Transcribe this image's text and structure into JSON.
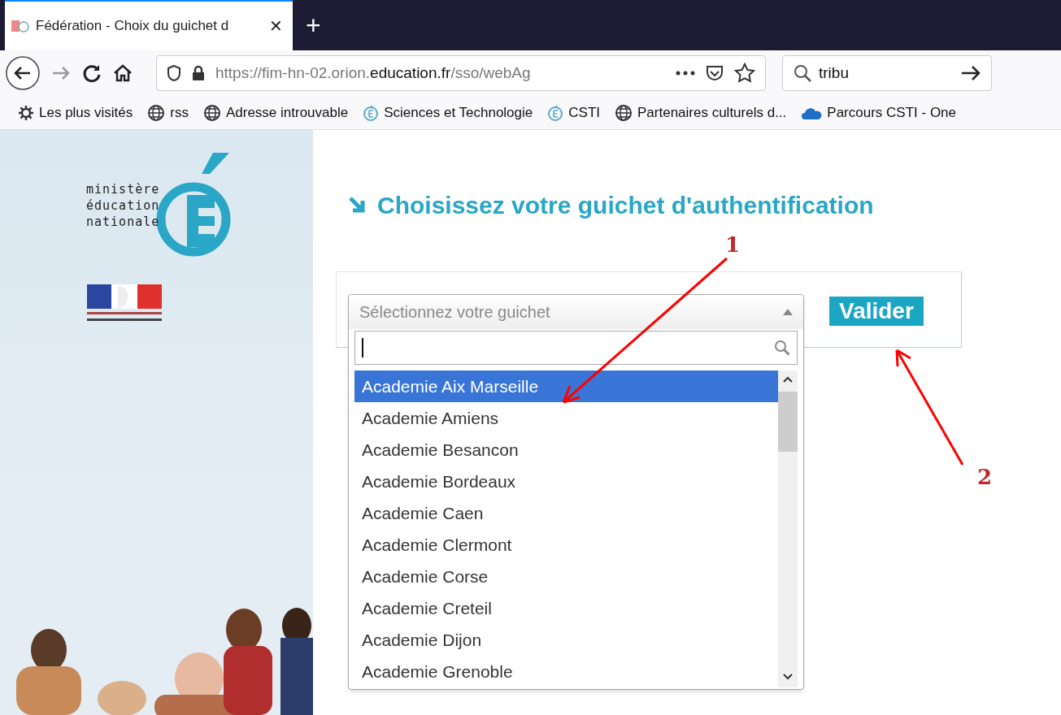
{
  "browser": {
    "tab": {
      "title": "Fédération - Choix du guichet d",
      "selected": true
    },
    "new_tab": "+",
    "close": "✕",
    "address": {
      "prefix": "https://fim-hn-02.orion.",
      "domain": "education.fr",
      "suffix": "/sso/webAg"
    },
    "search": {
      "value": "tribu"
    },
    "bookmarks": [
      {
        "label": "Les plus visités",
        "kind": "gear"
      },
      {
        "label": "rss",
        "kind": "globe"
      },
      {
        "label": "Adresse introuvable",
        "kind": "globe"
      },
      {
        "label": "Sciences et Technologie",
        "kind": "logo"
      },
      {
        "label": "CSTI",
        "kind": "logo"
      },
      {
        "label": "Partenaires culturels d...",
        "kind": "globe"
      },
      {
        "label": "Parcours CSTI - One",
        "kind": "cloud"
      }
    ]
  },
  "logo": {
    "lines": [
      "ministère",
      "éducation",
      "nationale"
    ]
  },
  "heading": "Choisissez votre guichet d'authentification",
  "select": {
    "placeholder": "Sélectionnez votre guichet",
    "expanded": true,
    "options": [
      {
        "label": "Academie Aix Marseille",
        "selected": true
      },
      {
        "label": "Academie Amiens",
        "selected": false
      },
      {
        "label": "Academie Besancon",
        "selected": false
      },
      {
        "label": "Academie Bordeaux",
        "selected": false
      },
      {
        "label": "Academie Caen",
        "selected": false
      },
      {
        "label": "Academie Clermont",
        "selected": false
      },
      {
        "label": "Academie Corse",
        "selected": false
      },
      {
        "label": "Academie Creteil",
        "selected": false
      },
      {
        "label": "Academie Dijon",
        "selected": false
      },
      {
        "label": "Academie Grenoble",
        "selected": false
      }
    ]
  },
  "submit": "Valider",
  "annotations": [
    {
      "label": "1"
    },
    {
      "label": "2"
    }
  ]
}
